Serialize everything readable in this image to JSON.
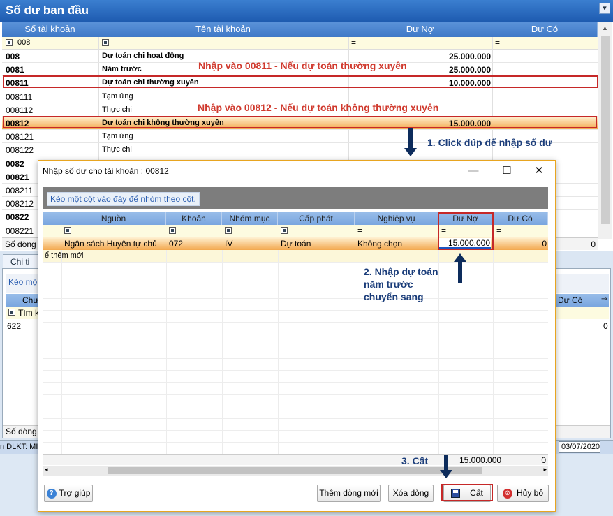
{
  "main": {
    "title": "Số dư ban đầu",
    "columns": [
      "Số tài khoản",
      "Tên tài khoản",
      "Dư Nợ",
      "Dư Có"
    ],
    "filter_value": "008",
    "rows": [
      {
        "code": "008",
        "name": "Dự toán chi hoạt động",
        "debit": "25.000.000",
        "bold": true
      },
      {
        "code": "0081",
        "name": "Năm trước",
        "debit": "25.000.000",
        "bold": true
      },
      {
        "code": "00811",
        "name": "Dự toán chi thường xuyên",
        "debit": "10.000.000",
        "bold": true
      },
      {
        "code": "008111",
        "name": "Tạm ứng",
        "debit": "",
        "bold": false
      },
      {
        "code": "008112",
        "name": "Thực chi",
        "debit": "",
        "bold": false
      },
      {
        "code": "00812",
        "name": "Dự toán chi không thường xuyên",
        "debit": "15.000.000",
        "bold": true
      },
      {
        "code": "008121",
        "name": "Tạm ứng",
        "debit": "",
        "bold": false
      },
      {
        "code": "008122",
        "name": "Thực chi",
        "debit": "",
        "bold": false
      },
      {
        "code": "0082",
        "name": "",
        "debit": "",
        "bold": true
      },
      {
        "code": "00821",
        "name": "",
        "debit": "",
        "bold": true
      },
      {
        "code": "008211",
        "name": "",
        "debit": "",
        "bold": false
      },
      {
        "code": "008212",
        "name": "",
        "debit": "",
        "bold": false
      },
      {
        "code": "00822",
        "name": "",
        "debit": "",
        "bold": true
      },
      {
        "code": "008221",
        "name": "",
        "debit": "",
        "bold": false
      }
    ],
    "footer_label": "Số dòng",
    "footer_total": "0",
    "lower_tab": "Chi ti",
    "lower_group_hint": "Kéo mộ",
    "lower_col_right": "Dư Có",
    "lower_filter": "Tìm k",
    "lower_row_code": "622",
    "lower_row_value": "0",
    "lower_footer_label": "Số dòng",
    "status_left": "n DLKT: MI",
    "status_date": "03/07/2020"
  },
  "annotations": {
    "note1": "Nhập vào 00811 - Nếu dự toán thường xuyên",
    "note2": "Nhập vào 00812 - Nếu dự toán không thường xuyên",
    "step1": "1. Click đúp để nhập số dư",
    "step2_line1": "2. Nhập dự toán",
    "step2_line2": "năm trước",
    "step2_line3": "chuyển sang",
    "step3": "3. Cất"
  },
  "dialog": {
    "title": "Nhập số dư cho tài khoản : 00812",
    "group_hint": "Kéo một cột vào đây để nhóm theo cột.",
    "columns": [
      "Nguồn",
      "Khoản",
      "Nhóm mục",
      "Cấp phát",
      "Nghiệp vụ",
      "Dư Nợ",
      "Dư Có"
    ],
    "row": {
      "source": "Ngân sách Huyện tự chủ",
      "khoan": "072",
      "nhom_muc": "IV",
      "cap_phat": "Dự toán",
      "nghiep_vu": "Không chọn",
      "debit": "15.000.000",
      "credit": "0"
    },
    "new_row_hint": "ể thêm mới",
    "footer_debit": "15.000.000",
    "footer_credit": "0",
    "buttons": {
      "help": "Trợ giúp",
      "add_row": "Thêm dòng mới",
      "delete_row": "Xóa dòng",
      "save": "Cất",
      "cancel": "Hủy bỏ"
    }
  },
  "colors": {
    "accent_red": "#c62828",
    "title_blue": "#1e5bb0",
    "arrow": "#0d2c5c"
  }
}
